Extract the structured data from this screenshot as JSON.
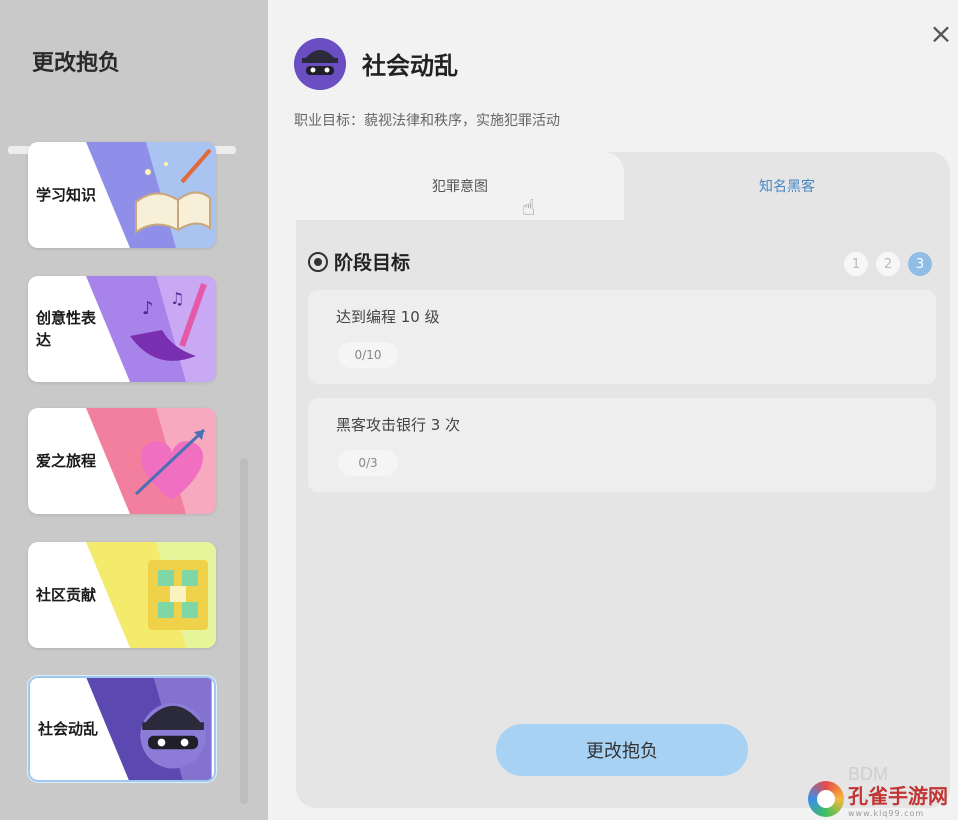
{
  "sidebar": {
    "title": "更改抱负",
    "items": [
      {
        "label": "学习知识",
        "icon": "book-icon"
      },
      {
        "label": "创意性表达",
        "icon": "paintbrush-icon"
      },
      {
        "label": "爱之旅程",
        "icon": "heart-arrow-icon"
      },
      {
        "label": "社区贡献",
        "icon": "community-icon"
      },
      {
        "label": "社会动乱",
        "icon": "bandit-icon",
        "selected": true
      }
    ]
  },
  "header": {
    "close_label": "×",
    "title": "社会动乱",
    "goal": "职业目标：藐视法律和秩序，实施犯罪活动"
  },
  "tabs": [
    {
      "label": "犯罪意图",
      "active": true
    },
    {
      "label": "知名黑客",
      "active": false
    }
  ],
  "stage": {
    "heading": "阶段目标",
    "steps": [
      "1",
      "2",
      "3"
    ],
    "current_step": "3"
  },
  "tasks": [
    {
      "text": "达到编程 10 级",
      "progress": "0/10"
    },
    {
      "text": "黑客攻击银行 3 次",
      "progress": "0/3"
    }
  ],
  "confirm_button": "更改抱负",
  "watermark": {
    "bdm": "BDM",
    "name": "孔雀手游网",
    "url": "www.klq99.com"
  },
  "colors": {
    "accent": "#a8d2f4",
    "tab_active_text": "#4a88c7",
    "sidebar_bg": "#c9c9c9"
  }
}
